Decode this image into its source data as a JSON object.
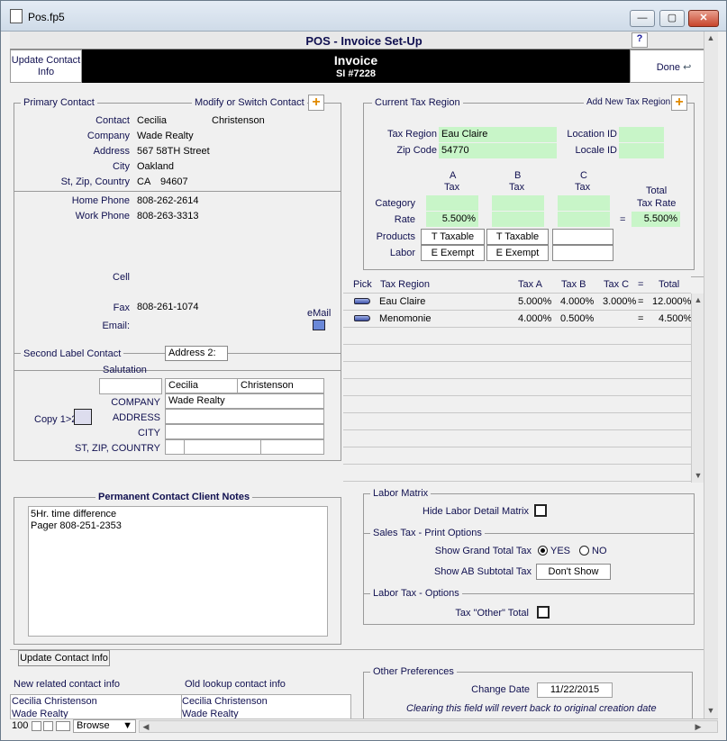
{
  "window": {
    "title": "Pos.fp5",
    "minimize": "—",
    "maximize": "▢",
    "close": "✕"
  },
  "header": {
    "title": "POS - Invoice Set-Up",
    "help": "?"
  },
  "banner": {
    "line1": "Invoice",
    "line2": "SI #7228"
  },
  "buttons": {
    "update_contact_info": "Update Contact Info",
    "done": "Done",
    "update_contact_info_bottom": "Update Contact Info",
    "dont_show": "Don't Show"
  },
  "primary_contact": {
    "label": "Primary Contact",
    "modify_label": "Modify or Switch Contact",
    "contact_label": "Contact",
    "first": "Cecilia",
    "last": "Christenson",
    "company_label": "Company",
    "company": "Wade Realty",
    "address_label": "Address",
    "address": "567 58TH Street",
    "city_label": "City",
    "city": "Oakland",
    "stzip_label": "St, Zip, Country",
    "state": "CA",
    "zip": "94607",
    "home_phone_label": "Home Phone",
    "home_phone": "808-262-2614",
    "work_phone_label": "Work Phone",
    "work_phone": "808-263-3313",
    "cell_label": "Cell",
    "fax_label": "Fax",
    "fax": "808-261-1074",
    "email_label": "Email:",
    "email_button": "eMail"
  },
  "second_label": {
    "label": "Second Label Contact",
    "address_tab": "Address 2:",
    "salutation_label": "Salutation",
    "first": "Cecilia",
    "last": "Christenson",
    "company_label": "COMPANY",
    "company": "Wade Realty",
    "address_label": "ADDRESS",
    "city_label": "CITY",
    "stzip_label": "ST, ZIP, COUNTRY",
    "copy_label": "Copy 1>2"
  },
  "notes": {
    "title": "Permanent Contact Client Notes",
    "line1": "5Hr.  time difference",
    "line2": "Pager 808-251-2353"
  },
  "tax": {
    "group_label": "Current Tax Region",
    "add_label": "Add New Tax Region",
    "region_label": "Tax Region",
    "region": "Eau Claire",
    "zip_label": "Zip Code",
    "zip": "54770",
    "location_label": "Location ID",
    "locale_label": "Locale ID",
    "col_a": "A",
    "col_a2": "Tax",
    "col_b": "B",
    "col_b2": "Tax",
    "col_c": "C",
    "col_c2": "Tax",
    "total_label": "Total",
    "total_label2": "Tax Rate",
    "category_label": "Category",
    "rate_label": "Rate",
    "rate_a": "5.500%",
    "eq": "=",
    "total_rate": "5.500%",
    "products_label": "Products",
    "products_a": "T   Taxable",
    "products_b": "T   Taxable",
    "labor_label": "Labor",
    "labor_a": "E   Exempt",
    "labor_b": "E   Exempt"
  },
  "table": {
    "headers": {
      "pick": "Pick",
      "region": "Tax Region",
      "a": "Tax A",
      "b": "Tax B",
      "c": "Tax C",
      "eq": "=",
      "total": "Total"
    },
    "rows": [
      {
        "region": "Eau Claire",
        "a": "5.000%",
        "b": "4.000%",
        "c": "3.000%",
        "eq": "=",
        "total": "12.000%"
      },
      {
        "region": "Menomonie",
        "a": "4.000%",
        "b": "0.500%",
        "c": "",
        "eq": "=",
        "total": "4.500%"
      }
    ]
  },
  "options": {
    "labor_matrix": "Labor Matrix",
    "hide_labor": "Hide Labor Detail Matrix",
    "sales_tax": "Sales Tax - Print Options",
    "show_grand": "Show Grand Total Tax",
    "yes": "YES",
    "no": "NO",
    "show_ab": "Show AB Subtotal Tax",
    "labor_tax": "Labor Tax  - Options",
    "tax_other": "Tax \"Other\" Total"
  },
  "bottom": {
    "new_related": "New related contact info",
    "old_lookup": "Old lookup contact info",
    "new_name": "Cecilia Christenson",
    "new_company": "Wade Realty",
    "old_name": "Cecilia Christenson",
    "old_company": "Wade Realty"
  },
  "other_prefs": {
    "label": "Other Preferences",
    "change_date_label": "Change Date",
    "change_date": "11/22/2015",
    "note": "Clearing this field will revert back to original creation date"
  },
  "status": {
    "zoom": "100",
    "mode": "Browse"
  }
}
